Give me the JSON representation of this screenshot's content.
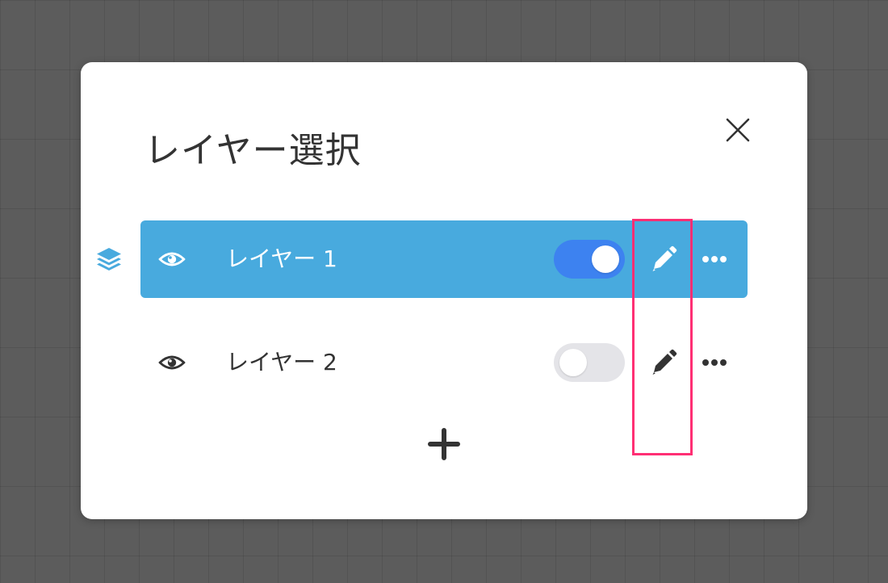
{
  "modal": {
    "title": "レイヤー選択"
  },
  "layers": [
    {
      "label": "レイヤー 1",
      "selected": true,
      "toggle_on": true
    },
    {
      "label": "レイヤー 2",
      "selected": false,
      "toggle_on": false
    }
  ],
  "icons": {
    "layers": "layers-icon",
    "visibility": "eye-icon",
    "edit": "pencil-icon",
    "more": "more-horizontal-icon",
    "close": "close-icon",
    "add": "plus-icon"
  },
  "colors": {
    "selected_row": "#48aade",
    "toggle_on": "#3d82f0",
    "toggle_off": "#e4e4e8",
    "highlight": "#ff2f74",
    "backdrop": "#5c5c5c"
  }
}
